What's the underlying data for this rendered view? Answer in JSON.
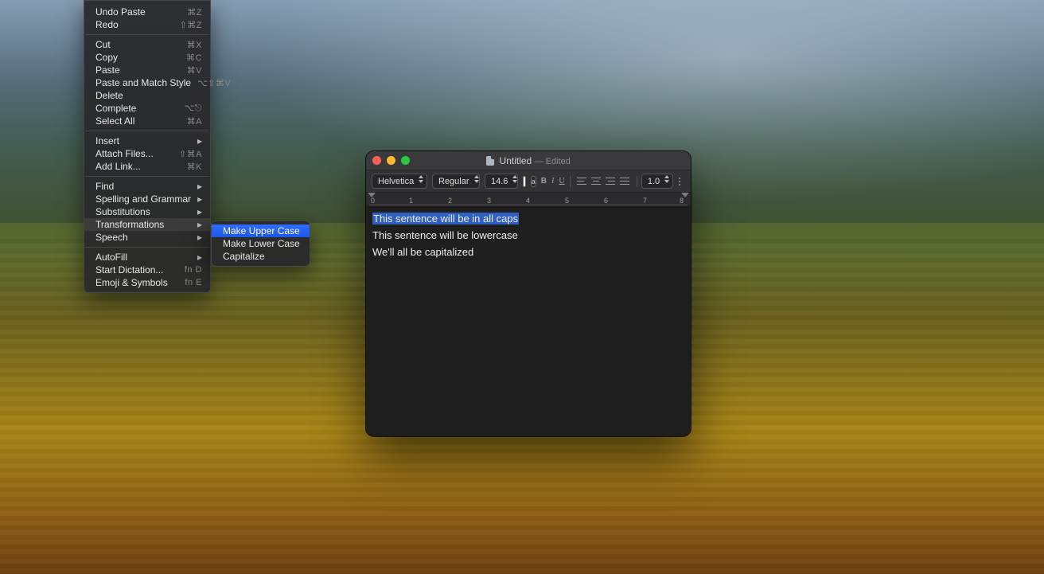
{
  "window": {
    "docName": "Untitled",
    "edited": "— Edited"
  },
  "toolbar": {
    "fontFamily": "Helvetica",
    "fontStyle": "Regular",
    "fontSize": "14.6",
    "lineSpacing": "1.0",
    "bold": "B",
    "italic": "I",
    "underline": "U",
    "a_letter": "a"
  },
  "ruler": {
    "ticks": [
      "0",
      "1",
      "2",
      "3",
      "4",
      "5",
      "6",
      "7",
      "8"
    ]
  },
  "document": {
    "line1": "This sentence will be in all caps",
    "line2": "This sentence will be lowercase",
    "line3": "We'll all be capitalized"
  },
  "menu": {
    "undo": {
      "label": "Undo Paste",
      "shortcut": "⌘Z"
    },
    "redo": {
      "label": "Redo",
      "shortcut": "⇧⌘Z"
    },
    "cut": {
      "label": "Cut",
      "shortcut": "⌘X"
    },
    "copy": {
      "label": "Copy",
      "shortcut": "⌘C"
    },
    "paste": {
      "label": "Paste",
      "shortcut": "⌘V"
    },
    "pasteMatch": {
      "label": "Paste and Match Style",
      "shortcut": "⌥⇧⌘V"
    },
    "delete": {
      "label": "Delete",
      "shortcut": ""
    },
    "complete": {
      "label": "Complete",
      "shortcut": "⌥⎋"
    },
    "selectAll": {
      "label": "Select All",
      "shortcut": "⌘A"
    },
    "insert": {
      "label": "Insert"
    },
    "attach": {
      "label": "Attach Files...",
      "shortcut": "⇧⌘A"
    },
    "addLink": {
      "label": "Add Link...",
      "shortcut": "⌘K"
    },
    "find": {
      "label": "Find"
    },
    "spelling": {
      "label": "Spelling and Grammar"
    },
    "subs": {
      "label": "Substitutions"
    },
    "transform": {
      "label": "Transformations"
    },
    "speech": {
      "label": "Speech"
    },
    "autofill": {
      "label": "AutoFill"
    },
    "dictation": {
      "label": "Start Dictation...",
      "shortcut": "fn D"
    },
    "emoji": {
      "label": "Emoji & Symbols",
      "shortcut": "fn E"
    },
    "upper": {
      "label": "Make Upper Case"
    },
    "lower": {
      "label": "Make Lower Case"
    },
    "capitalize": {
      "label": "Capitalize"
    }
  }
}
